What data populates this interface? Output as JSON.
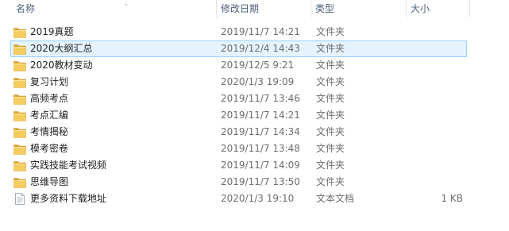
{
  "columns": {
    "name": "名称",
    "date": "修改日期",
    "type": "类型",
    "size": "大小"
  },
  "files": [
    {
      "name": "2019真题",
      "date": "2019/11/7 14:21",
      "type": "文件夹",
      "size": "",
      "icon": "folder-icon"
    },
    {
      "name": "2020大纲汇总",
      "date": "2019/12/4 14:43",
      "type": "文件夹",
      "size": "",
      "icon": "folder-icon"
    },
    {
      "name": "2020教材变动",
      "date": "2019/12/5 9:21",
      "type": "文件夹",
      "size": "",
      "icon": "folder-icon"
    },
    {
      "name": "复习计划",
      "date": "2020/1/3 19:09",
      "type": "文件夹",
      "size": "",
      "icon": "folder-icon"
    },
    {
      "name": "高频考点",
      "date": "2019/11/7 13:46",
      "type": "文件夹",
      "size": "",
      "icon": "folder-icon"
    },
    {
      "name": "考点汇编",
      "date": "2019/11/7 14:21",
      "type": "文件夹",
      "size": "",
      "icon": "folder-icon"
    },
    {
      "name": "考情揭秘",
      "date": "2019/11/7 14:34",
      "type": "文件夹",
      "size": "",
      "icon": "folder-icon"
    },
    {
      "name": "模考密卷",
      "date": "2019/11/7 13:48",
      "type": "文件夹",
      "size": "",
      "icon": "folder-icon"
    },
    {
      "name": "实践技能考试视频",
      "date": "2019/11/7 14:09",
      "type": "文件夹",
      "size": "",
      "icon": "folder-icon"
    },
    {
      "name": "思维导图",
      "date": "2019/11/7 13:50",
      "type": "文件夹",
      "size": "",
      "icon": "folder-icon"
    },
    {
      "name": "更多资料下载地址",
      "date": "2020/1/3 19:10",
      "type": "文本文档",
      "size": "1 KB",
      "icon": "text-file-icon"
    }
  ],
  "selected_index": 1,
  "colors": {
    "header_text": "#4c607a",
    "selection_bg": "#e5f3ff",
    "selection_border": "#99d1ff",
    "folder": "#f0c35a"
  }
}
